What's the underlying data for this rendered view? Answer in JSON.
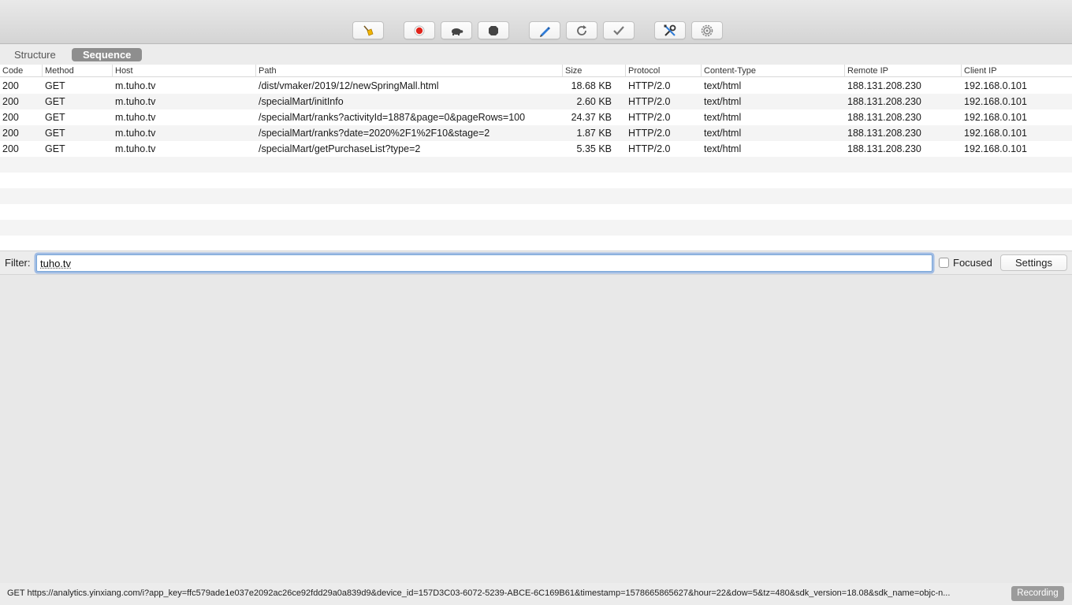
{
  "toolbar": {
    "buttons": [
      {
        "icon": "broom-icon"
      },
      {
        "icon": "record-icon"
      },
      {
        "icon": "turtle-icon"
      },
      {
        "icon": "stop-icon"
      },
      {
        "icon": "pen-icon"
      },
      {
        "icon": "repeat-icon"
      },
      {
        "icon": "validate-icon"
      },
      {
        "icon": "tools-icon"
      },
      {
        "icon": "settings-icon"
      }
    ]
  },
  "colors": {
    "record": "#e0241b",
    "pen": "#2f7bd6"
  },
  "tabs": {
    "structure": "Structure",
    "sequence": "Sequence",
    "active": "Sequence"
  },
  "table": {
    "headers": {
      "code": "Code",
      "method": "Method",
      "host": "Host",
      "path": "Path",
      "size": "Size",
      "protocol": "Protocol",
      "content_type": "Content-Type",
      "remote_ip": "Remote IP",
      "client_ip": "Client IP"
    },
    "rows": [
      {
        "code": "200",
        "method": "GET",
        "host": "m.tuho.tv",
        "path": "/dist/vmaker/2019/12/newSpringMall.html",
        "size": "18.68 KB",
        "protocol": "HTTP/2.0",
        "content_type": "text/html",
        "remote_ip": "188.131.208.230",
        "client_ip": "192.168.0.101"
      },
      {
        "code": "200",
        "method": "GET",
        "host": "m.tuho.tv",
        "path": "/specialMart/initInfo",
        "size": "2.60 KB",
        "protocol": "HTTP/2.0",
        "content_type": "text/html",
        "remote_ip": "188.131.208.230",
        "client_ip": "192.168.0.101"
      },
      {
        "code": "200",
        "method": "GET",
        "host": "m.tuho.tv",
        "path": "/specialMart/ranks?activityId=1887&page=0&pageRows=100",
        "size": "24.37 KB",
        "protocol": "HTTP/2.0",
        "content_type": "text/html",
        "remote_ip": "188.131.208.230",
        "client_ip": "192.168.0.101"
      },
      {
        "code": "200",
        "method": "GET",
        "host": "m.tuho.tv",
        "path": "/specialMart/ranks?date=2020%2F1%2F10&stage=2",
        "size": "1.87 KB",
        "protocol": "HTTP/2.0",
        "content_type": "text/html",
        "remote_ip": "188.131.208.230",
        "client_ip": "192.168.0.101"
      },
      {
        "code": "200",
        "method": "GET",
        "host": "m.tuho.tv",
        "path": "/specialMart/getPurchaseList?type=2",
        "size": "5.35 KB",
        "protocol": "HTTP/2.0",
        "content_type": "text/html",
        "remote_ip": "188.131.208.230",
        "client_ip": "192.168.0.101"
      }
    ]
  },
  "filter": {
    "label": "Filter:",
    "value": "tuho.tv",
    "focused_label": "Focused",
    "focused_checked": false,
    "settings_label": "Settings"
  },
  "status": {
    "text": "GET https://analytics.yinxiang.com/i?app_key=ffc579ade1e037e2092ac26ce92fdd29a0a839d9&device_id=157D3C03-6072-5239-ABCE-6C169B61&timestamp=1578665865627&hour=22&dow=5&tz=480&sdk_version=18.08&sdk_name=objc-n...",
    "recording_label": "Recording"
  }
}
